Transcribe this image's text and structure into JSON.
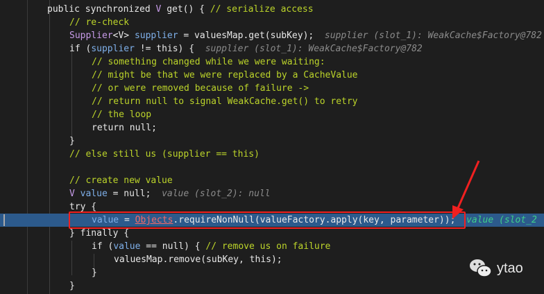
{
  "code_lines": [
    {
      "indent": 0,
      "tokens": [
        {
          "t": "public synchronized ",
          "c": "kw"
        },
        {
          "t": "V",
          "c": "ty"
        },
        {
          "t": " get() { ",
          "c": "kw"
        },
        {
          "t": "// serialize access",
          "c": "cm"
        }
      ]
    },
    {
      "indent": 1,
      "tokens": [
        {
          "t": "// re-check",
          "c": "cm"
        }
      ]
    },
    {
      "indent": 1,
      "tokens": [
        {
          "t": "Supplier",
          "c": "ty"
        },
        {
          "t": "<V> ",
          "c": "txt"
        },
        {
          "t": "supplier",
          "c": "var"
        },
        {
          "t": " = valuesMap.get(subKey);  ",
          "c": "txt"
        },
        {
          "t": "supplier (slot_1): WeakCache$Factory@782",
          "c": "hint"
        }
      ]
    },
    {
      "indent": 1,
      "tokens": [
        {
          "t": "if (",
          "c": "kw"
        },
        {
          "t": "supplier",
          "c": "var"
        },
        {
          "t": " != this) {  ",
          "c": "kw"
        },
        {
          "t": "supplier (slot_1): WeakCache$Factory@782",
          "c": "hint"
        }
      ]
    },
    {
      "indent": 2,
      "tokens": [
        {
          "t": "// something changed while we were waiting:",
          "c": "cm"
        }
      ]
    },
    {
      "indent": 2,
      "tokens": [
        {
          "t": "// might be that we were replaced by a CacheValue",
          "c": "cm"
        }
      ]
    },
    {
      "indent": 2,
      "tokens": [
        {
          "t": "// or were removed because of failure ->",
          "c": "cm"
        }
      ]
    },
    {
      "indent": 2,
      "tokens": [
        {
          "t": "// return null to signal WeakCache.get() to retry",
          "c": "cm"
        }
      ]
    },
    {
      "indent": 2,
      "tokens": [
        {
          "t": "// the loop",
          "c": "cm"
        }
      ]
    },
    {
      "indent": 2,
      "tokens": [
        {
          "t": "return null;",
          "c": "kw"
        }
      ]
    },
    {
      "indent": 1,
      "tokens": [
        {
          "t": "}",
          "c": "kw"
        }
      ]
    },
    {
      "indent": 1,
      "tokens": [
        {
          "t": "// else still us (supplier == this)",
          "c": "cm"
        }
      ]
    },
    {
      "indent": 0,
      "tokens": []
    },
    {
      "indent": 1,
      "tokens": [
        {
          "t": "// create new value",
          "c": "cm"
        }
      ]
    },
    {
      "indent": 1,
      "tokens": [
        {
          "t": "V ",
          "c": "ty"
        },
        {
          "t": "value",
          "c": "var"
        },
        {
          "t": " = null;  ",
          "c": "kw"
        },
        {
          "t": "value (slot_2): null",
          "c": "hint"
        }
      ]
    },
    {
      "indent": 1,
      "tokens": [
        {
          "t": "try {",
          "c": "kw"
        }
      ]
    },
    {
      "indent": 2,
      "highlight": true,
      "tokens": [
        {
          "t": "value",
          "c": "var"
        },
        {
          "t": " = ",
          "c": "txt"
        },
        {
          "t": "Objects",
          "c": "err"
        },
        {
          "t": ".requireNonNull(valueFactory.apply(key, parameter));  ",
          "c": "txt"
        },
        {
          "t": "value (slot_2",
          "c": "hintg"
        }
      ]
    },
    {
      "indent": 1,
      "tokens": [
        {
          "t": "} finally {",
          "c": "kw"
        }
      ]
    },
    {
      "indent": 2,
      "tokens": [
        {
          "t": "if (",
          "c": "kw"
        },
        {
          "t": "value",
          "c": "var"
        },
        {
          "t": " == null) { ",
          "c": "kw"
        },
        {
          "t": "// remove us on failure",
          "c": "cm"
        }
      ]
    },
    {
      "indent": 3,
      "tokens": [
        {
          "t": "valuesMap.remove(subKey, this);",
          "c": "txt"
        }
      ]
    },
    {
      "indent": 2,
      "tokens": [
        {
          "t": "}",
          "c": "kw"
        }
      ]
    },
    {
      "indent": 1,
      "tokens": [
        {
          "t": "}",
          "c": "kw"
        }
      ]
    }
  ],
  "watermark": {
    "label": "ytao",
    "icon": "wechat-icon"
  },
  "colors": {
    "annotation": "#f02020",
    "highlight": "#2c5a8c"
  }
}
